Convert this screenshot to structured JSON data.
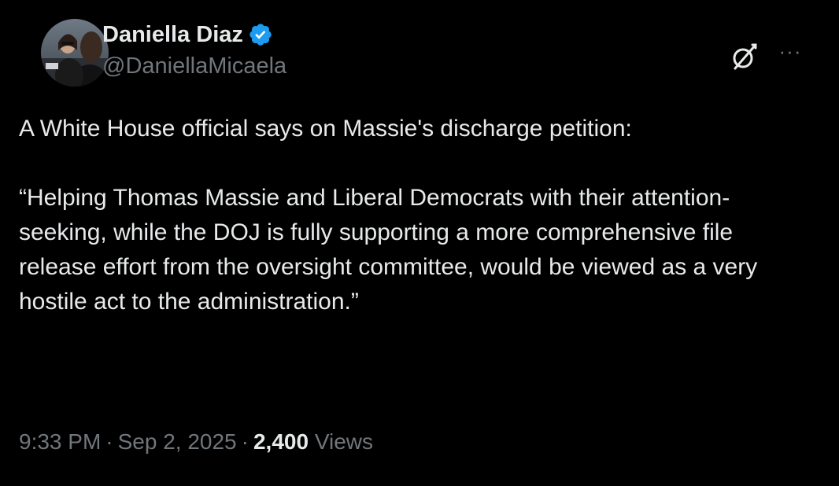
{
  "author": {
    "display_name": "Daniella Diaz",
    "handle": "@DaniellaMicaela",
    "verified": true
  },
  "tweet": {
    "paragraphs": [
      "A White House official says on Massie's discharge petition:",
      "“Helping Thomas Massie and Liberal Democrats with their attention-seeking, while the DOJ is fully supporting a more comprehensive file release effort from the oversight committee, would be viewed as a very hostile act to the administration.”"
    ]
  },
  "meta": {
    "time": "9:33 PM",
    "separator": "·",
    "date": "Sep 2, 2025",
    "views_count": "2,400",
    "views_label": "Views"
  },
  "actions": {
    "more_label": "···"
  },
  "icons": {
    "verified": "verified-badge-icon",
    "grok": "grok-icon",
    "more": "more-options-icon"
  },
  "colors": {
    "background": "#000000",
    "primary_text": "#e7e9ea",
    "secondary_text": "#71767b",
    "verified_blue": "#1d9bf0"
  }
}
